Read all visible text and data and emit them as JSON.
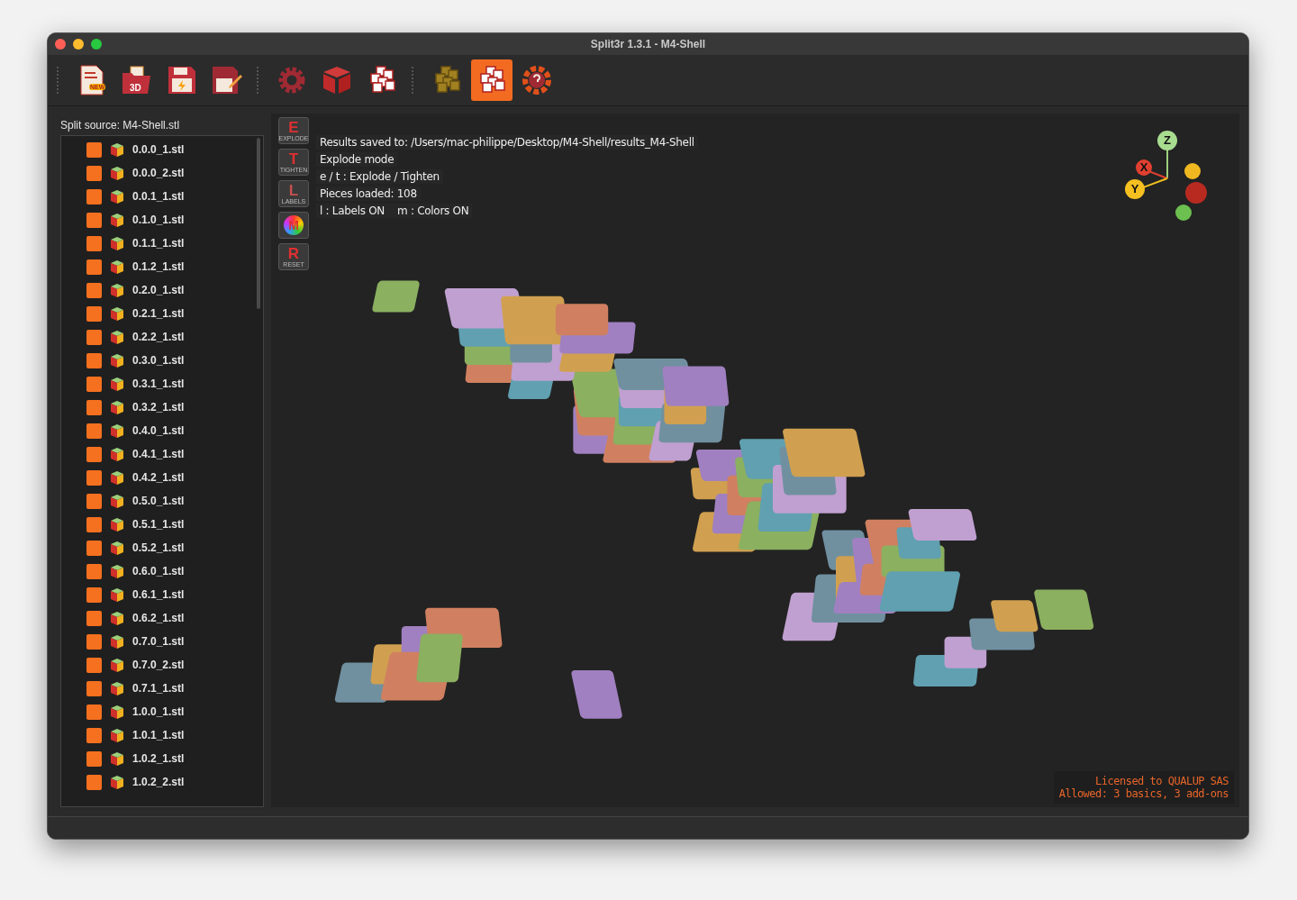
{
  "window": {
    "title": "Split3r 1.3.1 - M4-Shell"
  },
  "toolbar": {
    "groups": [
      [
        {
          "kind": "new",
          "badge": "NEW",
          "selected": false
        },
        {
          "kind": "open3d",
          "badge": "3D",
          "selected": false
        },
        {
          "kind": "save",
          "selected": false
        },
        {
          "kind": "saveas",
          "selected": false
        }
      ],
      [
        {
          "kind": "gear",
          "selected": false
        },
        {
          "kind": "cube",
          "selected": false
        },
        {
          "kind": "cubes",
          "selected": false
        }
      ],
      [
        {
          "kind": "cubes-gold",
          "selected": false
        },
        {
          "kind": "explode",
          "selected": true
        },
        {
          "kind": "help",
          "selected": false
        }
      ]
    ]
  },
  "sidebar": {
    "title": "Split source: M4-Shell.stl",
    "items": [
      "0.0.0_1.stl",
      "0.0.0_2.stl",
      "0.0.1_1.stl",
      "0.1.0_1.stl",
      "0.1.1_1.stl",
      "0.1.2_1.stl",
      "0.2.0_1.stl",
      "0.2.1_1.stl",
      "0.2.2_1.stl",
      "0.3.0_1.stl",
      "0.3.1_1.stl",
      "0.3.2_1.stl",
      "0.4.0_1.stl",
      "0.4.1_1.stl",
      "0.4.2_1.stl",
      "0.5.0_1.stl",
      "0.5.1_1.stl",
      "0.5.2_1.stl",
      "0.6.0_1.stl",
      "0.6.1_1.stl",
      "0.6.2_1.stl",
      "0.7.0_1.stl",
      "0.7.0_2.stl",
      "0.7.1_1.stl",
      "1.0.0_1.stl",
      "1.0.1_1.stl",
      "1.0.2_1.stl",
      "1.0.2_2.stl"
    ]
  },
  "viewport": {
    "side_buttons": [
      {
        "letter": "E",
        "caption": "EXPLODE",
        "kind": "letter"
      },
      {
        "letter": "T",
        "caption": "TIGHTEN",
        "kind": "letter"
      },
      {
        "letter": "L",
        "caption": "LABELS",
        "kind": "dim"
      },
      {
        "letter": "M",
        "kind": "ring"
      },
      {
        "letter": "R",
        "caption": "RESET",
        "kind": "letter"
      }
    ],
    "info_lines": [
      "Results saved to: /Users/mac-philippe/Desktop/M4-Shell/results_M4-Shell",
      "Explode mode",
      "e / t : Explode / Tighten",
      "Pieces loaded: 108",
      "l : Labels ON    m : Colors ON"
    ],
    "axes": [
      "Z",
      "X",
      "Y"
    ],
    "license": [
      "Licensed to QUALUP SAS",
      "Allowed: 3 basics, 3 add-ons"
    ]
  }
}
